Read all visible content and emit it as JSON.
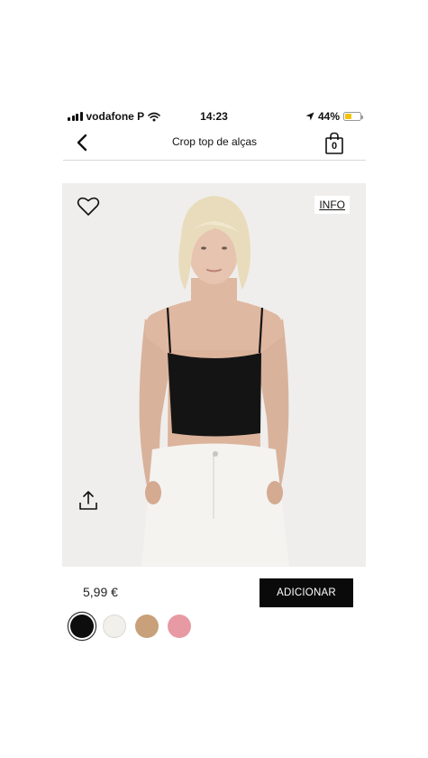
{
  "status_bar": {
    "carrier": "vodafone P",
    "time": "14:23",
    "battery": "44%",
    "battery_level": 0.44
  },
  "nav": {
    "title": "Crop top de alças",
    "bag_count": "0"
  },
  "product": {
    "info_label": "INFO",
    "price": "5,99 €",
    "add_label": "ADICIONAR",
    "swatches": [
      {
        "color": "#0d0d0d",
        "selected": true
      },
      {
        "color": "#f2f0ea",
        "selected": false
      },
      {
        "color": "#c8a17a",
        "selected": false
      },
      {
        "color": "#e79aa3",
        "selected": false
      }
    ]
  }
}
